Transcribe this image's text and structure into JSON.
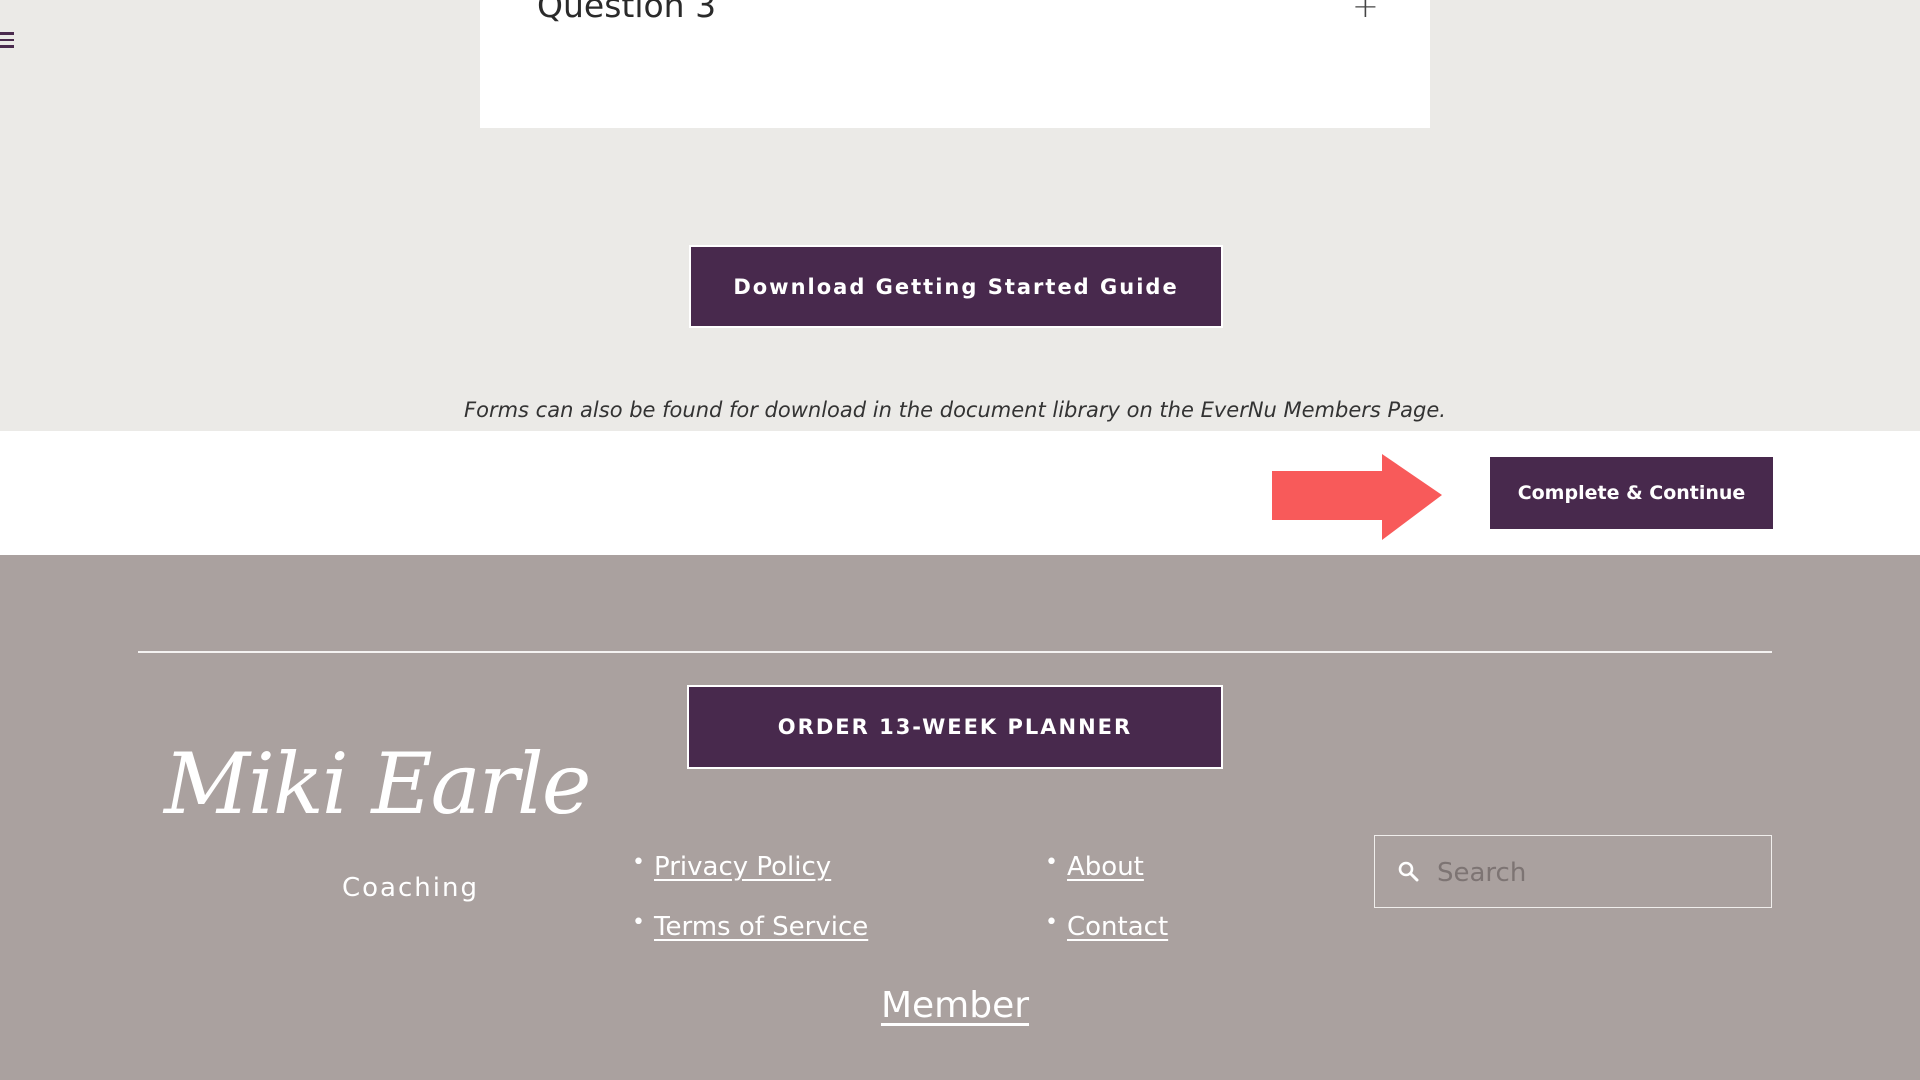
{
  "faq": {
    "question": "Question 3",
    "expand_symbol": "+"
  },
  "download_button": "Download Getting Started Guide",
  "forms_note": "Forms can also be found for download in the document library on the EverNu Members Page.",
  "complete_button": "Complete & Continue",
  "footer": {
    "planner_button": "ORDER 13-WEEK PLANNER",
    "logo": {
      "script": "Miki Earle",
      "subtitle": "Coaching"
    },
    "links": [
      "Privacy Policy",
      "Terms of Service",
      "About",
      "Contact"
    ],
    "search_placeholder": "Search",
    "member_link": "Member"
  },
  "colors": {
    "brand_purple": "#48294d",
    "page_bg": "#ebeae7",
    "footer_bg": "#aaa19f",
    "arrow": "#f85a5a"
  },
  "icons": {
    "menu": "hamburger-menu-icon",
    "search": "search-icon",
    "arrow": "right-arrow-icon"
  }
}
